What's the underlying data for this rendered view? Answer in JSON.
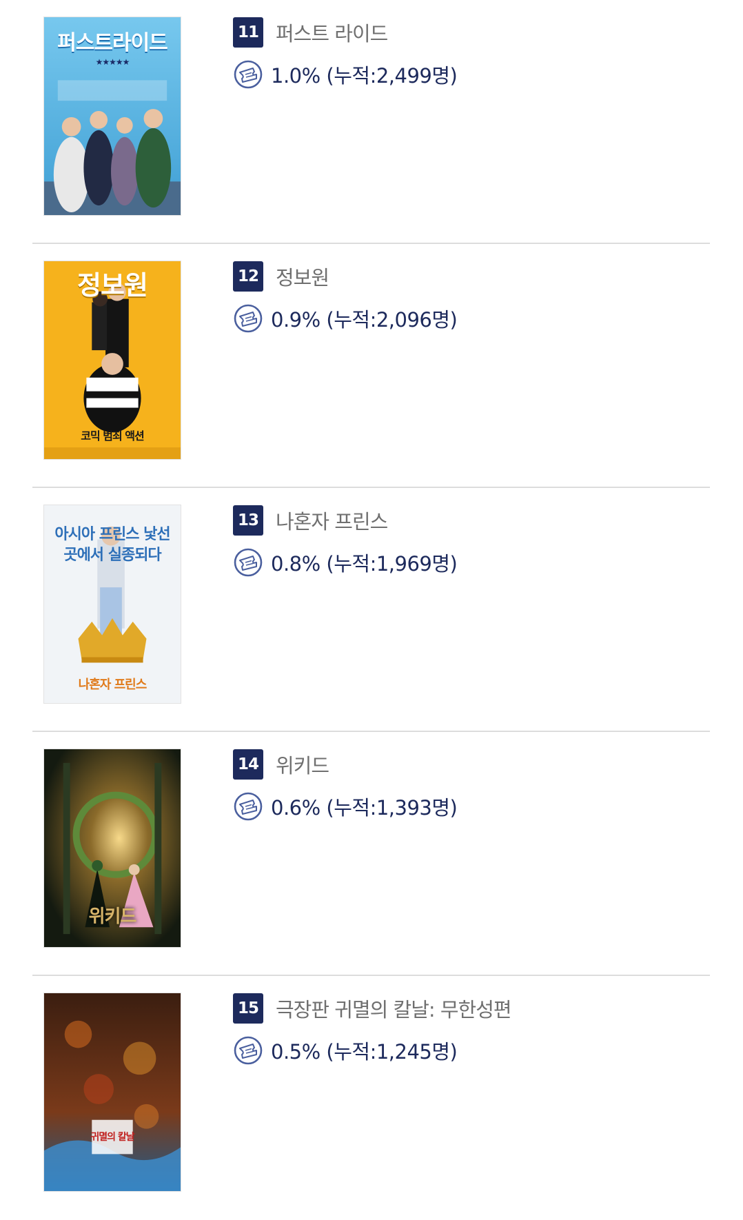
{
  "movies": [
    {
      "rank": "11",
      "title": "퍼스트 라이드",
      "stat": "1.0% (누적:2,499명)",
      "poster": {
        "headline": "퍼스트라이드",
        "tagline": "★★★★★",
        "bg": "#5bb7e3",
        "fg": "#ffffff"
      }
    },
    {
      "rank": "12",
      "title": "정보원",
      "stat": "0.9% (누적:2,096명)",
      "poster": {
        "headline": "정보원",
        "tagline": "코믹 범죄 액션",
        "bg": "#f6b21c",
        "fg": "#ffffff"
      }
    },
    {
      "rank": "13",
      "title": "나혼자 프린스",
      "stat": "0.8% (누적:1,969명)",
      "poster": {
        "headline": "아시아 프린스 낯선 곳에서 실종되다",
        "tagline": "나혼자 프린스",
        "bg": "#f1f4f7",
        "fg": "#2d6fb8"
      }
    },
    {
      "rank": "14",
      "title": "위키드",
      "stat": "0.6% (누적:1,393명)",
      "poster": {
        "headline": "위키드",
        "tagline": "",
        "bg": "#1f2a1a",
        "fg": "#d8b56a"
      }
    },
    {
      "rank": "15",
      "title": "극장판 귀멸의 칼날: 무한성편",
      "stat": "0.5% (누적:1,245명)",
      "poster": {
        "headline": "귀멸의 칼날",
        "tagline": "",
        "bg": "#4a2515",
        "fg": "#ffffff"
      }
    }
  ],
  "colors": {
    "rank_badge": "#1d2a5c",
    "title_text": "#6f6f6f",
    "stat_text": "#1d2a5c",
    "divider": "#dcdcdc"
  },
  "icons": {
    "ticket": "ticket-icon"
  }
}
